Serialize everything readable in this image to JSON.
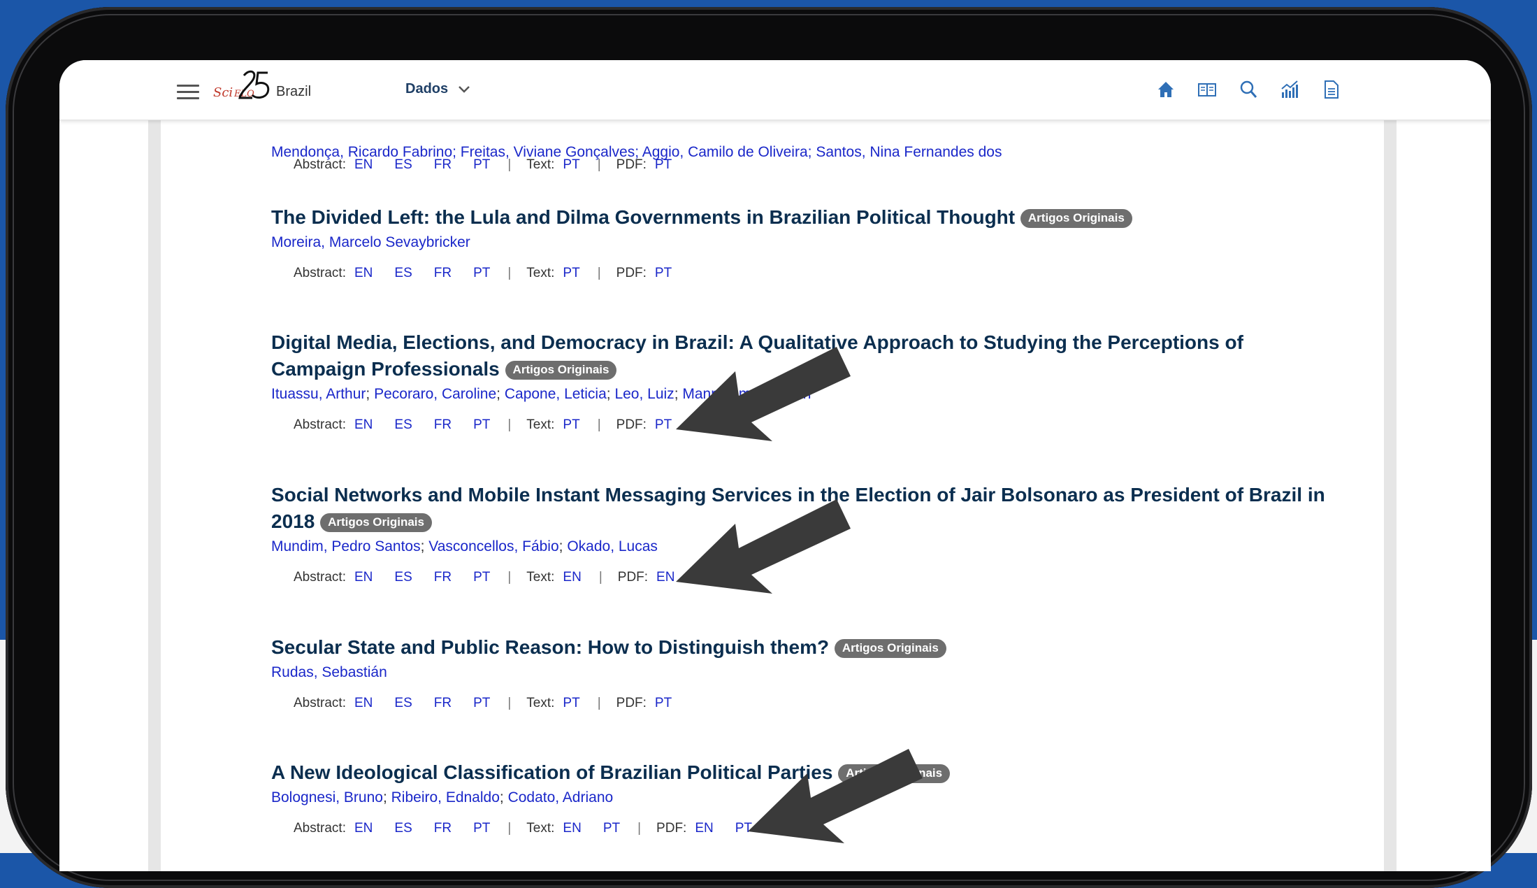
{
  "header": {
    "menu_icon": "hamburger-menu-icon",
    "logo_icon": "scielo-25-logo",
    "logo_text": "SciELO 25",
    "country": "Brazil",
    "nav_label": "Dados",
    "icons": [
      "home-icon",
      "journal-icon",
      "search-icon",
      "metrics-chart-icon",
      "document-icon"
    ]
  },
  "truncated_authors": "Mendonça, Ricardo Fabrino; Freitas, Viviane Gonçalves; Aggio, Camilo de Oliveira; Santos, Nina Fernandes dos",
  "labels": {
    "abstract": "Abstract:",
    "text": "Text:",
    "pdf": "PDF:",
    "pipe": "|"
  },
  "articles": [
    {
      "title": "The Divided Left: the Lula and Dilma Governments in Brazilian Political Thought",
      "badge": "Artigos Originais",
      "authors": [
        "Moreira, Marcelo Sevaybricker"
      ],
      "abstract": [
        "EN",
        "ES",
        "FR",
        "PT"
      ],
      "text": [
        "PT"
      ],
      "pdf": [
        "PT"
      ]
    },
    {
      "title": "Digital Media, Elections, and Democracy in Brazil: A Qualitative Approach to Studying the Perceptions of Campaign Professionals",
      "badge": "Artigos Originais",
      "authors": [
        "Ituassu, Arthur",
        "Pecoraro, Caroline",
        "Capone, Leticia",
        "Leo, Luiz",
        "Mannheimer, Vivian"
      ],
      "abstract": [
        "EN",
        "ES",
        "FR",
        "PT"
      ],
      "text": [
        "PT"
      ],
      "pdf": [
        "PT"
      ]
    },
    {
      "title": "Social Networks and Mobile Instant Messaging Services in the Election of Jair Bolsonaro as President of Brazil in 2018",
      "badge": "Artigos Originais",
      "authors": [
        "Mundim, Pedro Santos",
        "Vasconcellos, Fábio",
        "Okado, Lucas"
      ],
      "abstract": [
        "EN",
        "ES",
        "FR",
        "PT"
      ],
      "text": [
        "EN"
      ],
      "pdf": [
        "EN"
      ]
    },
    {
      "title": "Secular State and Public Reason: How to Distinguish them?",
      "badge": "Artigos Originais",
      "authors": [
        "Rudas, Sebastián"
      ],
      "abstract": [
        "EN",
        "ES",
        "FR",
        "PT"
      ],
      "text": [
        "PT"
      ],
      "pdf": [
        "PT"
      ]
    },
    {
      "title": "A New Ideological Classification of Brazilian Political Parties",
      "badge": "Artigos Originais",
      "authors": [
        "Bolognesi, Bruno",
        "Ribeiro, Ednaldo",
        "Codato, Adriano"
      ],
      "abstract": [
        "EN",
        "ES",
        "FR",
        "PT"
      ],
      "text": [
        "EN",
        "PT"
      ],
      "pdf": [
        "EN",
        "PT"
      ]
    }
  ],
  "annotations": {
    "arrow_icon": "annotation-arrow-icon",
    "arrow_color": "#3a3a3a"
  }
}
